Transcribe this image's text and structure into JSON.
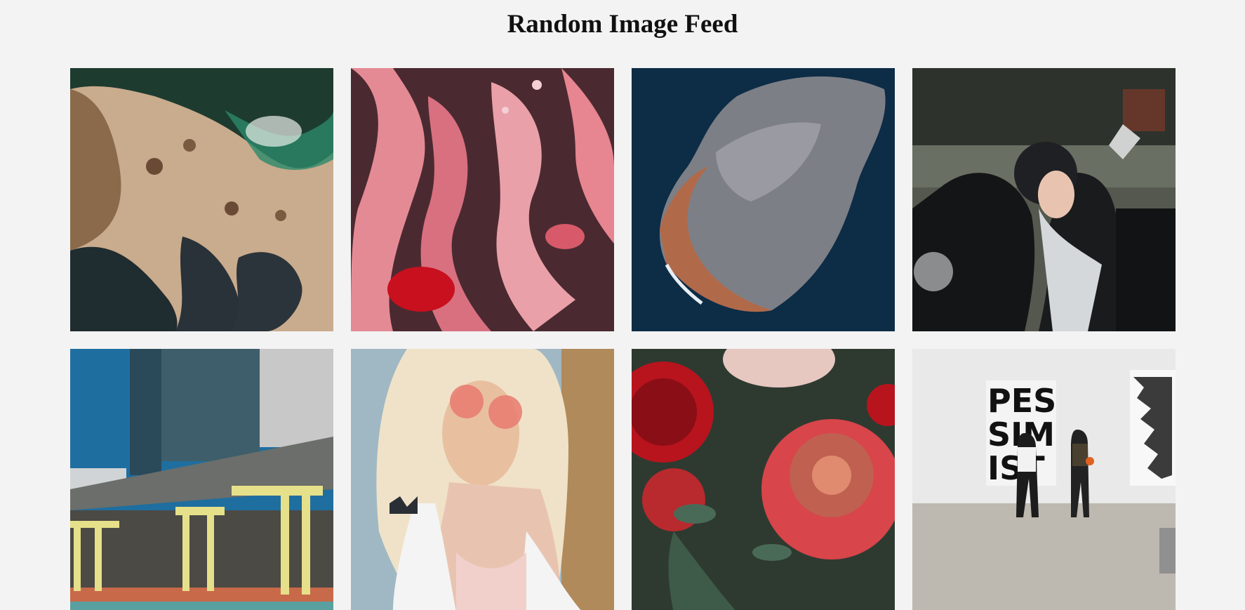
{
  "page": {
    "title": "Random Image Feed"
  },
  "feed": {
    "images": [
      {
        "subject": "aerial-rocky-coast"
      },
      {
        "subject": "abstract-pink-marble"
      },
      {
        "subject": "aerial-island-ocean"
      },
      {
        "subject": "woman-motorcycle-helmet"
      },
      {
        "subject": "city-plaza-yellow-frames"
      },
      {
        "subject": "woman-pink-sunglasses"
      },
      {
        "subject": "red-peony-flowers"
      },
      {
        "subject": "art-gallery-pessimist"
      }
    ]
  },
  "colors": {
    "background": "#f3f3f3",
    "title": "#111111"
  }
}
